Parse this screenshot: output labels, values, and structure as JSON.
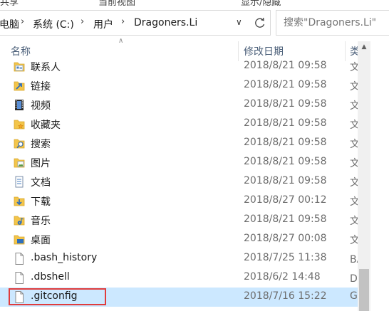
{
  "ribbon": {
    "cut_label_1": "共享",
    "cut_label_2": "当前视图",
    "cut_label_3": "显示/隐藏"
  },
  "address": {
    "crumbs": [
      "电脑",
      "系统 (C:)",
      "用户",
      "Dragoners.Li"
    ]
  },
  "search": {
    "placeholder": "搜索\"Dragoners.Li\""
  },
  "columns": {
    "name": "名称",
    "date": "修改日期",
    "type": "类型"
  },
  "files": [
    {
      "name": "联系人",
      "date": "2018/8/21 09:58",
      "type": "文件夹",
      "icon": "contacts-folder-icon"
    },
    {
      "name": "链接",
      "date": "2018/8/21 09:58",
      "type": "文件夹",
      "icon": "links-folder-icon"
    },
    {
      "name": "视频",
      "date": "2018/8/21 09:58",
      "type": "文件夹",
      "icon": "videos-folder-icon"
    },
    {
      "name": "收藏夹",
      "date": "2018/8/21 09:58",
      "type": "文件夹",
      "icon": "favorites-folder-icon"
    },
    {
      "name": "搜索",
      "date": "2018/8/21 09:58",
      "type": "文件夹",
      "icon": "searches-folder-icon"
    },
    {
      "name": "图片",
      "date": "2018/8/21 09:58",
      "type": "文件夹",
      "icon": "pictures-folder-icon"
    },
    {
      "name": "文档",
      "date": "2018/8/21 09:58",
      "type": "文件夹",
      "icon": "documents-folder-icon"
    },
    {
      "name": "下载",
      "date": "2018/8/27 00:12",
      "type": "文件夹",
      "icon": "downloads-folder-icon"
    },
    {
      "name": "音乐",
      "date": "2018/8/21 09:58",
      "type": "文件夹",
      "icon": "music-folder-icon"
    },
    {
      "name": "桌面",
      "date": "2018/8/27 00:08",
      "type": "文件夹",
      "icon": "desktop-folder-icon"
    },
    {
      "name": ".bash_history",
      "date": "2018/7/25 11:38",
      "type": "BASH_HISTORY 文件",
      "icon": "file-icon"
    },
    {
      "name": ".dbshell",
      "date": "2018/6/2 14:48",
      "type": "DBSHELL 文件",
      "icon": "file-icon"
    },
    {
      "name": ".gitconfig",
      "date": "2018/7/16 15:22",
      "type": "Git Config",
      "icon": "file-icon"
    }
  ],
  "colors": {
    "selected_row": "#cce8ff",
    "highlight_border": "#e03c3c",
    "header_text": "#4c607a"
  }
}
